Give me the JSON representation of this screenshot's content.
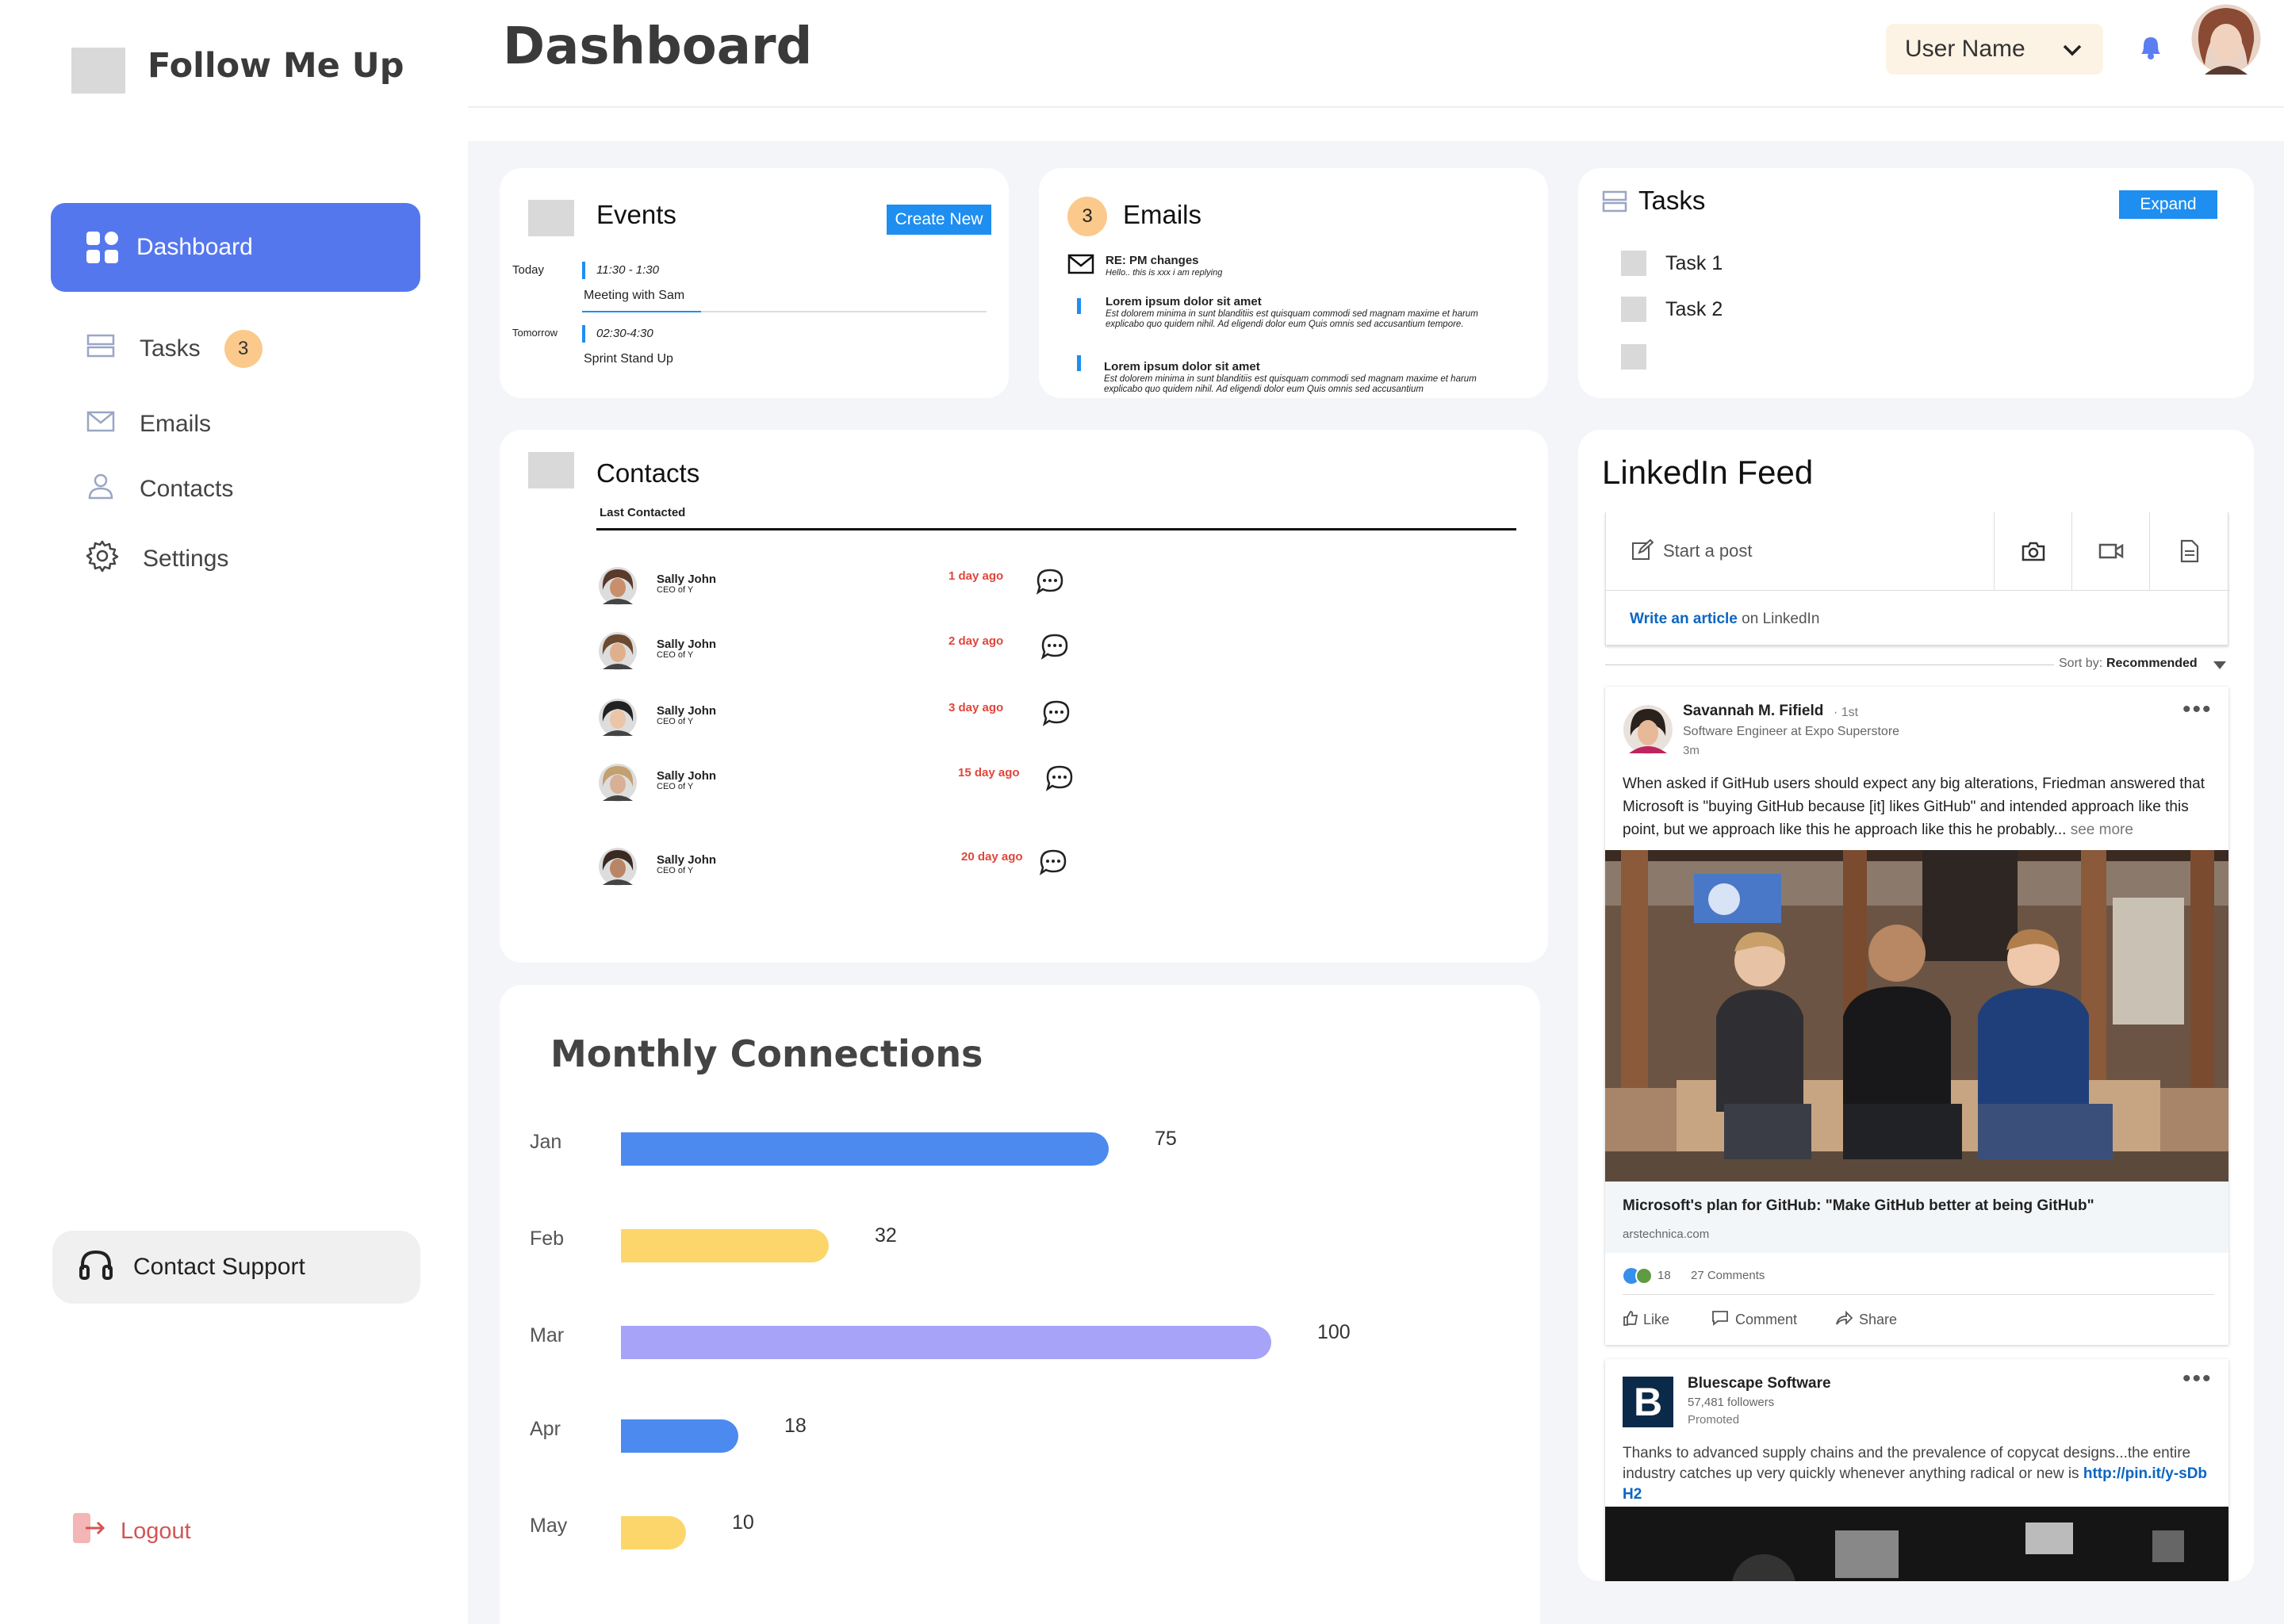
{
  "app": {
    "title": "Follow Me Up"
  },
  "header": {
    "page_title": "Dashboard",
    "user_name": "User Name"
  },
  "sidebar": {
    "items": [
      {
        "label": "Dashboard",
        "icon": "grid-icon",
        "active": true
      },
      {
        "label": "Tasks",
        "icon": "tasks-icon",
        "badge": "3"
      },
      {
        "label": "Emails",
        "icon": "mail-icon"
      },
      {
        "label": "Contacts",
        "icon": "user-icon"
      },
      {
        "label": "Settings",
        "icon": "gear-icon"
      }
    ],
    "support_label": "Contact Support",
    "logout_label": "Logout"
  },
  "events": {
    "title": "Events",
    "create_label": "Create New",
    "items": [
      {
        "day": "Today",
        "time": "11:30 - 1:30",
        "name": "Meeting with Sam"
      },
      {
        "day": "Tomorrow",
        "time": "02:30-4:30",
        "name": "Sprint Stand Up"
      }
    ]
  },
  "emails": {
    "title": "Emails",
    "count": "3",
    "items": [
      {
        "subject": "RE: PM changes",
        "preview": "Hello.. this is xxx i am replying"
      },
      {
        "subject": "Lorem ipsum dolor sit amet",
        "preview": "Est dolorem minima in sunt blanditiis est quisquam commodi sed magnam maxime et harum explicabo quo quidem nihil. Ad eligendi dolor eum Quis omnis sed accusantium tempore."
      },
      {
        "subject": "Lorem ipsum dolor sit amet",
        "preview": "Est dolorem minima in sunt blanditiis est quisquam commodi sed magnam maxime et harum explicabo quo quidem nihil. Ad eligendi dolor eum Quis omnis sed accusantium"
      }
    ]
  },
  "tasks": {
    "title": "Tasks",
    "expand_label": "Expand",
    "items": [
      "Task 1",
      "Task 2",
      ""
    ]
  },
  "contacts": {
    "title": "Contacts",
    "column": "Last Contacted",
    "rows": [
      {
        "name": "Sally John",
        "role": "CEO of Y",
        "last": "1 day ago"
      },
      {
        "name": "Sally John",
        "role": "CEO of Y",
        "last": "2 day ago"
      },
      {
        "name": "Sally John",
        "role": "CEO of Y",
        "last": "3 day ago"
      },
      {
        "name": "Sally John",
        "role": "CEO of Y",
        "last": "15 day ago"
      },
      {
        "name": "Sally John",
        "role": "CEO of Y",
        "last": "20 day ago"
      }
    ]
  },
  "chart_data": {
    "type": "bar",
    "orientation": "horizontal",
    "title": "Monthly Connections",
    "categories": [
      "Jan",
      "Feb",
      "Mar",
      "Apr",
      "May"
    ],
    "values": [
      75,
      32,
      100,
      18,
      10
    ],
    "colors": [
      "#4d8af0",
      "#fdd66b",
      "#a7a3f8",
      "#4d8af0",
      "#fdd66b"
    ]
  },
  "linkedin": {
    "title": "LinkedIn Feed",
    "start_post": "Start a post",
    "write_article_link": "Write an article",
    "write_article_rest": "on LinkedIn",
    "sort_label": "Sort by:",
    "sort_value": "Recommended",
    "post1": {
      "author": "Savannah M. Fifield",
      "degree": "· 1st",
      "headline": "Software Engineer at Expo Superstore",
      "time": "3m",
      "text": "When asked if GitHub users should expect any big alterations, Friedman answered that Microsoft is \"buying GitHub because [it] likes GitHub\" and intended approach like this point, but we approach like this he approach like this he probably...",
      "see_more": "see more",
      "article_title": "Microsoft's plan for GitHub: \"Make GitHub better at being GitHub\"",
      "article_source": "arstechnica.com",
      "reactions": "18",
      "comments": "27 Comments",
      "actions": [
        "Like",
        "Comment",
        "Share"
      ]
    },
    "post2": {
      "company": "Bluescape Software",
      "followers": "57,481 followers",
      "promoted": "Promoted",
      "text": "Thanks to advanced supply chains and the prevalence of copycat designs...the entire industry catches up very quickly whenever anything radical or new is",
      "link": "http://pin.it/y-sDbH2",
      "logo_letter": "B"
    }
  }
}
